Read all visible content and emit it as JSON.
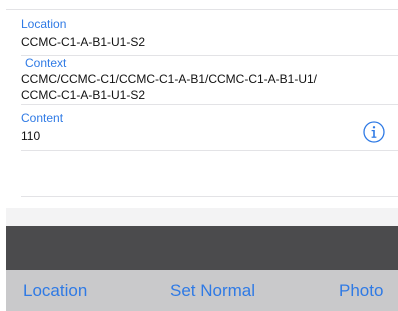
{
  "fields": {
    "location": {
      "label": "Location",
      "value": "CCMC-C1-A-B1-U1-S2"
    },
    "context": {
      "label": "Context",
      "value_line1": "CCMC/CCMC-C1/CCMC-C1-A-B1/CCMC-C1-A-B1-U1/",
      "value_line2": "CCMC-C1-A-B1-U1-S2"
    },
    "content": {
      "label": "Content",
      "value": "110"
    }
  },
  "icons": {
    "content_info": "info-circle-icon"
  },
  "toolbar": {
    "location_label": "Location",
    "set_normal_label": "Set Normal",
    "photo_label": "Photo"
  },
  "colors": {
    "accent": "#2f7ae5",
    "dark_bar": "#4b4b4d",
    "toolbar_bg": "#c9c9cb"
  }
}
